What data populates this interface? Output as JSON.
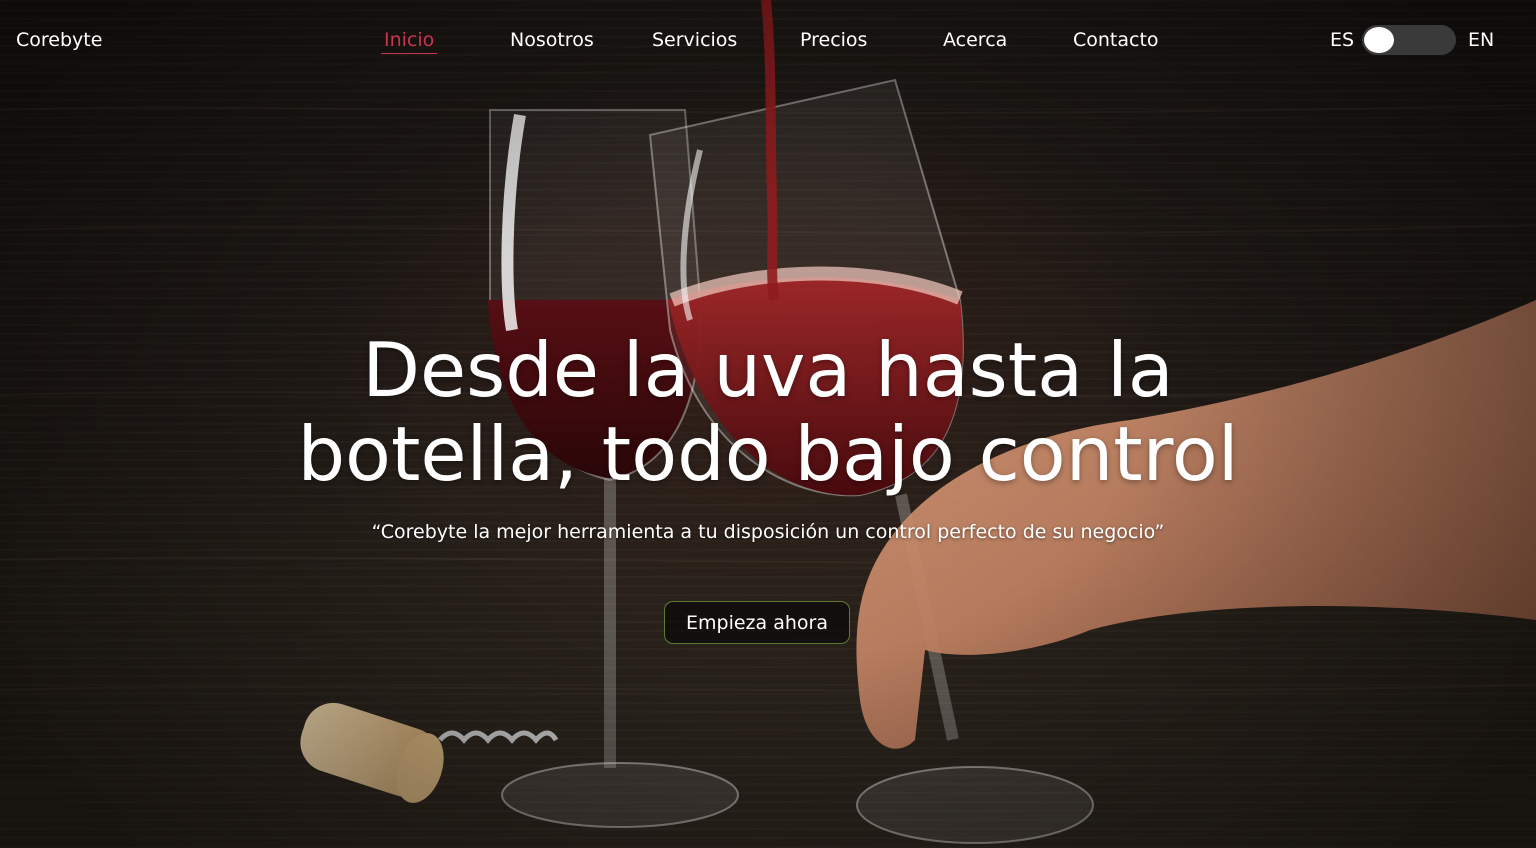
{
  "brand": {
    "name": "Corebyte"
  },
  "nav": {
    "items": [
      {
        "label": "Inicio",
        "active": true
      },
      {
        "label": "Nosotros",
        "active": false
      },
      {
        "label": "Servicios",
        "active": false
      },
      {
        "label": "Precios",
        "active": false
      },
      {
        "label": "Acerca",
        "active": false
      },
      {
        "label": "Contacto",
        "active": false
      }
    ]
  },
  "language": {
    "left_label": "ES",
    "right_label": "EN",
    "selected": "ES"
  },
  "hero": {
    "headline_line1": "Desde la uva hasta la",
    "headline_line2": "botella, todo bajo control",
    "tagline": "“Corebyte la mejor herramienta a tu disposición un control perfecto de su negocio”",
    "cta_label": "Empieza ahora"
  },
  "colors": {
    "active_nav": "#c9334d",
    "cta_border": "#5e7a32",
    "text": "#ffffff"
  },
  "icons": {
    "language_toggle": "toggle-switch"
  }
}
